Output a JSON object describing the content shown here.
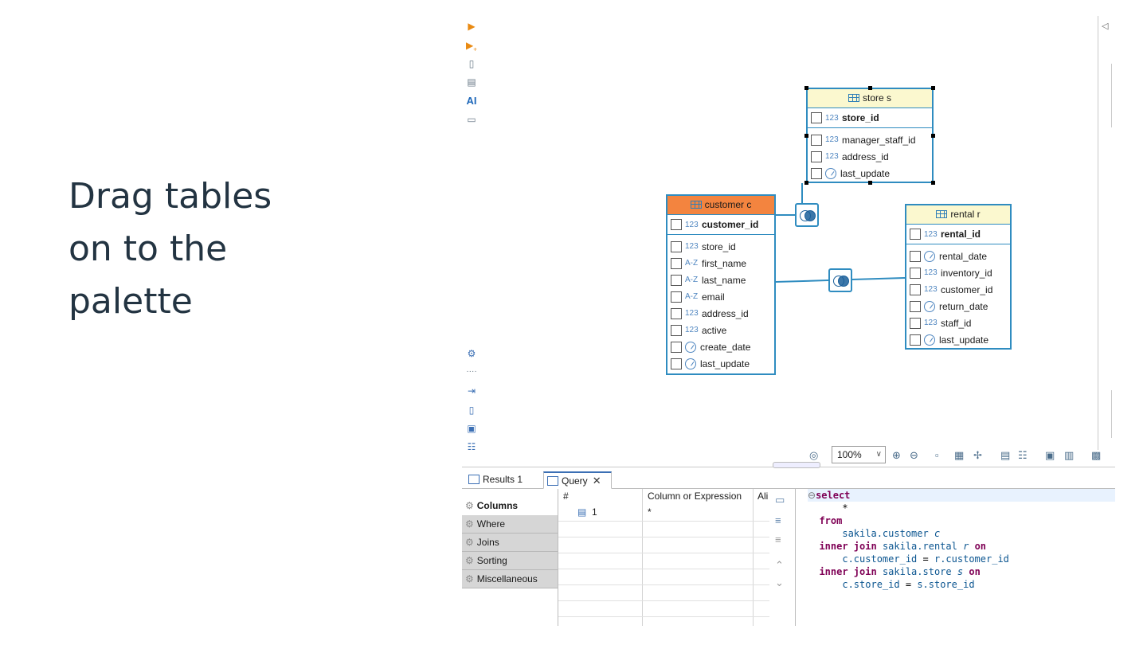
{
  "caption": {
    "line1": "Drag tables",
    "line2": "on to the",
    "line3": "palette"
  },
  "left_toolbar": {
    "ai_label": "AI"
  },
  "diagram": {
    "store": {
      "title": "store s",
      "pk": {
        "type": "123",
        "name": "store_id"
      },
      "fields": [
        {
          "type": "123",
          "name": "manager_staff_id"
        },
        {
          "type": "123",
          "name": "address_id"
        },
        {
          "type": "clock",
          "name": "last_update"
        }
      ]
    },
    "customer": {
      "title": "customer c",
      "pk": {
        "type": "123",
        "name": "customer_id"
      },
      "fields": [
        {
          "type": "123",
          "name": "store_id"
        },
        {
          "type": "A-Z",
          "name": "first_name"
        },
        {
          "type": "A-Z",
          "name": "last_name"
        },
        {
          "type": "A-Z",
          "name": "email"
        },
        {
          "type": "123",
          "name": "address_id"
        },
        {
          "type": "123",
          "name": "active"
        },
        {
          "type": "clock",
          "name": "create_date"
        },
        {
          "type": "clock",
          "name": "last_update"
        }
      ]
    },
    "rental": {
      "title": "rental r",
      "pk": {
        "type": "123",
        "name": "rental_id"
      },
      "fields": [
        {
          "type": "clock",
          "name": "rental_date"
        },
        {
          "type": "123",
          "name": "inventory_id"
        },
        {
          "type": "123",
          "name": "customer_id"
        },
        {
          "type": "clock",
          "name": "return_date"
        },
        {
          "type": "123",
          "name": "staff_id"
        },
        {
          "type": "clock",
          "name": "last_update"
        }
      ]
    }
  },
  "status_bar": {
    "zoom": "100%"
  },
  "tabs": {
    "results": "Results 1",
    "query": "Query"
  },
  "side_list": [
    "Columns",
    "Where",
    "Joins",
    "Sorting",
    "Miscellaneous"
  ],
  "grid": {
    "headers": {
      "num": "#",
      "expr": "Column or Expression",
      "alias": "Ali"
    },
    "rows": [
      {
        "num": "1",
        "expr": "*"
      }
    ]
  },
  "sql": {
    "select": "select",
    "star": "*",
    "from": "from",
    "t1": "sakila.customer",
    "a1": "c",
    "join1": "inner join",
    "t2": "sakila.rental",
    "a2": "r",
    "on": "on",
    "cond1a": "c.customer_id",
    "cond1b": "r.customer_id",
    "t3": "sakila.store",
    "a3": "s",
    "cond2a": "c.store_id",
    "cond2b": "s.store_id",
    "eq": "="
  },
  "colors": {
    "accent": "#2f8cc0",
    "header_yellow": "#fbf8cf",
    "header_orange": "#f3843f",
    "keyword": "#7f0055"
  }
}
